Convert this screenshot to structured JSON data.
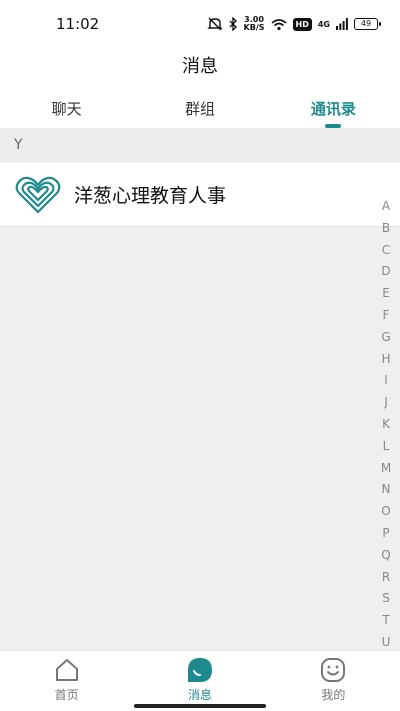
{
  "status_bar": {
    "time": "11:02",
    "net_speed_value": "3.00",
    "net_speed_unit": "KB/S",
    "hd": "HD",
    "signal": "4G",
    "battery": "49"
  },
  "header": {
    "title": "消息"
  },
  "tabs": [
    {
      "label": "聊天",
      "active": false
    },
    {
      "label": "群组",
      "active": false
    },
    {
      "label": "通讯录",
      "active": true
    }
  ],
  "contacts": {
    "section_letter": "Y",
    "items": [
      {
        "name": "洋葱心理教育人事"
      }
    ]
  },
  "alpha_index": [
    "A",
    "B",
    "C",
    "D",
    "E",
    "F",
    "G",
    "H",
    "I",
    "J",
    "K",
    "L",
    "M",
    "N",
    "O",
    "P",
    "Q",
    "R",
    "S",
    "T",
    "U"
  ],
  "bottom_nav": [
    {
      "label": "首页",
      "icon": "home-icon",
      "active": false
    },
    {
      "label": "消息",
      "icon": "message-icon",
      "active": true
    },
    {
      "label": "我的",
      "icon": "profile-icon",
      "active": false
    }
  ],
  "colors": {
    "accent": "#1f8a8e",
    "background": "#efefef"
  }
}
